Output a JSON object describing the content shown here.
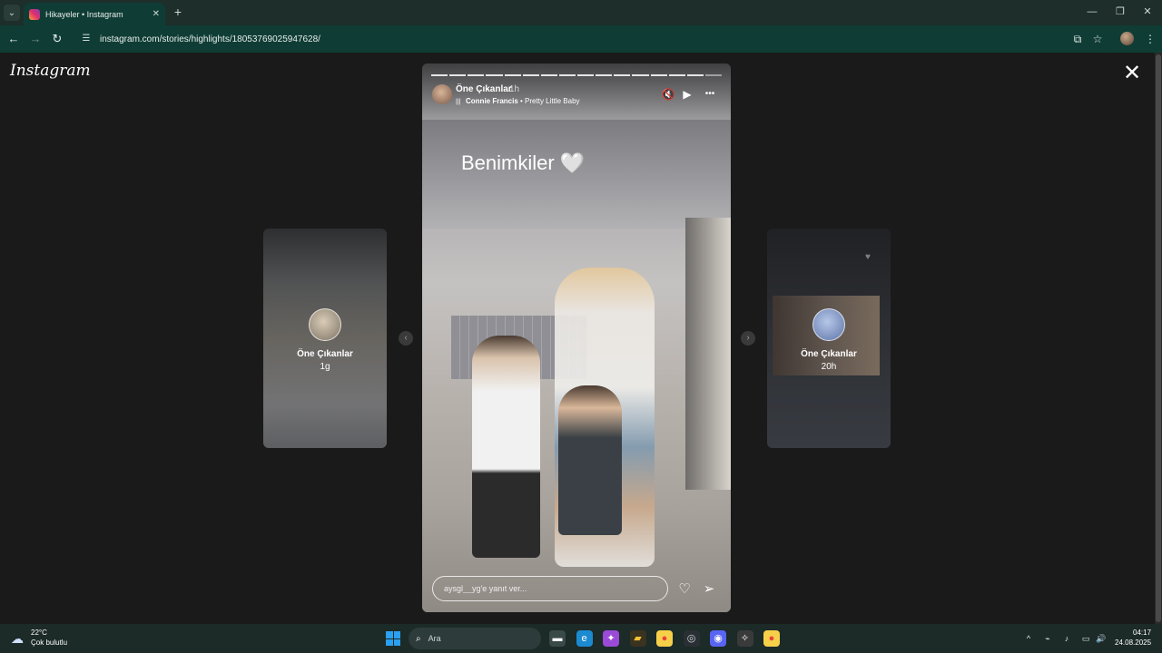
{
  "browser": {
    "tab_title": "Hikayeler • Instagram",
    "url": "instagram.com/stories/highlights/18053769025947628/",
    "tab_list_glyph": "⌄",
    "tab_close_glyph": "✕",
    "new_tab_glyph": "+",
    "minimize_glyph": "—",
    "restore_glyph": "❐",
    "close_glyph": "✕",
    "back_glyph": "←",
    "forward_glyph": "→",
    "reload_glyph": "↻",
    "site_info_glyph": "☰",
    "install_glyph": "⧉",
    "bookmark_glyph": "☆",
    "menu_glyph": "⋮"
  },
  "instagram": {
    "logo": "Instagram",
    "close_glyph": "✕"
  },
  "story": {
    "username": "Öne Çıkanlar",
    "time": "1h",
    "music_artist": "Connie Francis",
    "music_separator": " • ",
    "music_title": "Pretty Little Baby",
    "music_bars_glyph": "|||",
    "mute_glyph": "🔇",
    "play_glyph": "▶",
    "more_glyph": "•••",
    "caption": "Benimkiler",
    "caption_heart": "🤍",
    "reply_placeholder": "aysgl__yg'e yanıt ver...",
    "like_glyph": "♡",
    "share_glyph": "➢",
    "progress_segments": 16,
    "current_segment": 16
  },
  "previews": {
    "left": {
      "name": "Öne Çıkanlar",
      "time": "1g"
    },
    "right": {
      "name": "Öne Çıkanlar",
      "time": "20h",
      "heart_glyph": "♥"
    }
  },
  "nav_arrows": {
    "prev": "‹",
    "next": "›"
  },
  "taskbar": {
    "weather_temp": "22°C",
    "weather_desc": "Çok bulutlu",
    "weather_glyph": "☁",
    "search_label": "Ara",
    "search_glyph": "⌕",
    "time": "04:17",
    "date": "24.08.2025",
    "tray_chevron": "^",
    "tray_net": "⌁",
    "tray_mic": "♪",
    "tray_display": "▭",
    "tray_volume": "🔊"
  },
  "taskbar_apps": [
    {
      "name": "file-explorer",
      "glyph": "▬",
      "color": "#ffffff",
      "bg": "#3a4a48"
    },
    {
      "name": "edge",
      "glyph": "e",
      "color": "#ffffff",
      "bg": "#1b8ad0"
    },
    {
      "name": "copilot",
      "glyph": "✦",
      "color": "#ffffff",
      "bg": "#9a4ad6"
    },
    {
      "name": "folders",
      "glyph": "▰",
      "color": "#f1c232",
      "bg": "#3a3320"
    },
    {
      "name": "chrome",
      "glyph": "●",
      "color": "#e7443c",
      "bg": "#f7d04a"
    },
    {
      "name": "steam",
      "glyph": "◎",
      "color": "#cfd8d5",
      "bg": "#2a2f36"
    },
    {
      "name": "discord",
      "glyph": "◉",
      "color": "#ffffff",
      "bg": "#5865f2"
    },
    {
      "name": "git",
      "glyph": "✧",
      "color": "#ffffff",
      "bg": "#3a3a3a"
    },
    {
      "name": "chrome-active",
      "glyph": "●",
      "color": "#e7443c",
      "bg": "#f7d04a"
    }
  ]
}
